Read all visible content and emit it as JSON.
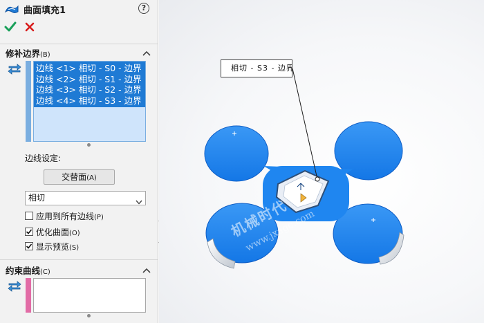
{
  "header": {
    "title": "曲面填充1",
    "help_symbol": "?"
  },
  "icons": {
    "feature": "surface-fill-icon",
    "ok": "checkmark-icon",
    "cancel": "close-icon",
    "help": "help-icon",
    "swap": "swap-direction-icon",
    "collapse": "chevron-up-icon",
    "dropdown": "chevron-down-icon"
  },
  "colors": {
    "accent_blue": "#1f7ad4",
    "selection_bg": "#cfe4fb",
    "ok_green": "#1aa05a",
    "cancel_red": "#d81b1b",
    "part_blue": "#1f86f0",
    "boundary_strip": "#7aaee0",
    "curve_strip": "#e26ca6"
  },
  "patch_boundary": {
    "title": "修补边界",
    "shortcut": "(B)",
    "edges": [
      "边线 <1> 相切 - S0 - 边界",
      "边线 <2> 相切 - S1 - 边界",
      "边线 <3> 相切 - S2 - 边界",
      "边线 <4> 相切 - S3 - 边界"
    ],
    "edge_settings_label": "边线设定:",
    "alternate_face_button": "交替面",
    "alternate_face_shortcut": "(A)",
    "condition_selected": "相切",
    "options": [
      {
        "label": "应用到所有边线",
        "shortcut": "(P)",
        "checked": false
      },
      {
        "label": "优化曲面",
        "shortcut": "(O)",
        "checked": true
      },
      {
        "label": "显示预览",
        "shortcut": "(S)",
        "checked": true
      }
    ]
  },
  "constraint_curves": {
    "title": "约束曲线",
    "shortcut": "(C)"
  },
  "viewport": {
    "callout_text": "相切 - S3 - 边界",
    "watermark_line1": "机械时代",
    "watermark_line2": "www.jxagc.com"
  }
}
